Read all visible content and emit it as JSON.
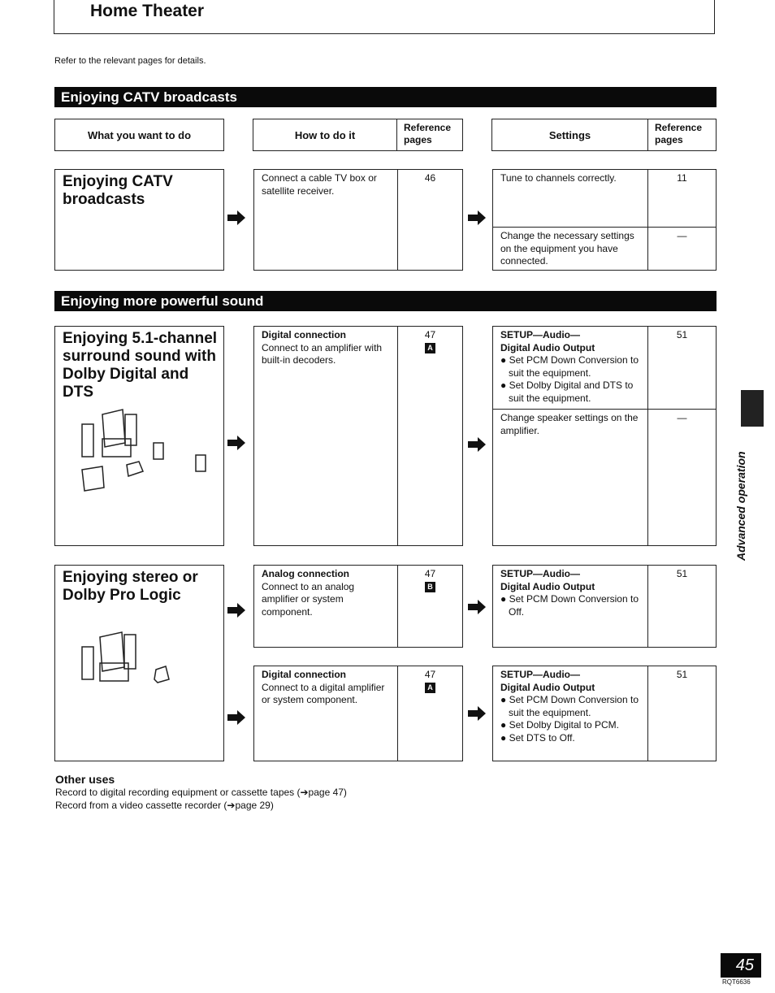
{
  "header": {
    "title": "Home Theater",
    "intro": "Refer to the relevant pages for details."
  },
  "columns": {
    "want": "What you want to do",
    "how": "How to do it",
    "how_ref": "Reference pages",
    "settings": "Settings",
    "settings_ref": "Reference pages"
  },
  "sections": [
    {
      "band": "Enjoying CATV broadcasts",
      "rows": [
        {
          "want": "Enjoying CATV broadcasts",
          "how": [
            {
              "heading": "",
              "text": "Connect a cable TV box or satellite receiver.",
              "ref": "46",
              "tag": ""
            }
          ],
          "settings": [
            {
              "heading": "",
              "subheading": "",
              "text": "Tune to channels correctly.",
              "bullets": [],
              "ref": "11"
            },
            {
              "heading": "",
              "subheading": "",
              "text": "Change the necessary settings on the equipment you have connected.",
              "bullets": [],
              "ref": "—"
            }
          ]
        }
      ]
    },
    {
      "band": "Enjoying more powerful sound",
      "rows": [
        {
          "want": "Enjoying 5.1-channel surround sound with Dolby Digital and DTS",
          "how": [
            {
              "heading": "Digital connection",
              "text": "Connect to an amplifier with built-in decoders.",
              "ref": "47",
              "tag": "A"
            }
          ],
          "settings": [
            {
              "heading": "SETUP—Audio—",
              "subheading": "Digital Audio Output",
              "text": "",
              "bullets": [
                "Set PCM Down Conversion to suit the equipment.",
                "Set Dolby Digital and DTS to suit the equipment."
              ],
              "ref": "51"
            },
            {
              "heading": "",
              "subheading": "",
              "text": "Change speaker settings on the amplifier.",
              "bullets": [],
              "ref": "—"
            }
          ]
        },
        {
          "want": "Enjoying stereo or Dolby Pro Logic",
          "how": [
            {
              "heading": "Analog connection",
              "text": "Connect to an analog amplifier or system component.",
              "ref": "47",
              "tag": "B"
            },
            {
              "heading": "Digital connection",
              "text": "Connect to a digital amplifier or system component.",
              "ref": "47",
              "tag": "A"
            }
          ],
          "settings": [
            {
              "heading": "SETUP—Audio—",
              "subheading": "Digital Audio Output",
              "text": "",
              "bullets": [
                "Set PCM Down Conversion to Off."
              ],
              "ref": "51"
            },
            {
              "heading": "SETUP—Audio—",
              "subheading": "Digital Audio Output",
              "text": "",
              "bullets": [
                "Set PCM Down Conversion to suit the equipment.",
                "Set Dolby Digital to PCM.",
                "Set DTS to Off."
              ],
              "ref": "51"
            }
          ]
        }
      ]
    }
  ],
  "other_uses": {
    "heading": "Other uses",
    "lines": [
      "Record to digital recording equipment or cassette tapes (➔page 47)",
      "Record from a video cassette recorder (➔page 29)"
    ]
  },
  "side_tab": {
    "label": "Advanced operation"
  },
  "footer": {
    "page_number": "45",
    "code": "RQT6636"
  }
}
